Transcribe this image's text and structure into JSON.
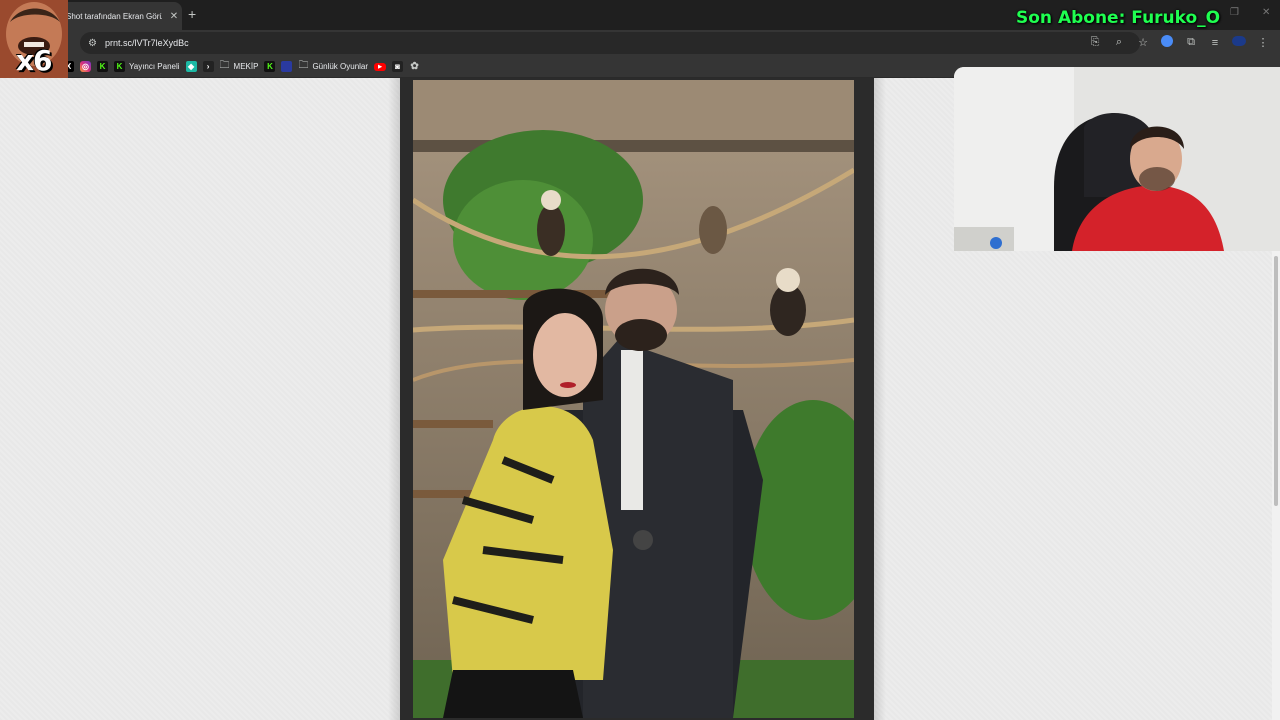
{
  "browser": {
    "tab_title": "Shot tarafından Ekran Görü",
    "tab_close": "✕",
    "new_tab": "+",
    "url": "prnt.sc/lVTr7leXydBc"
  },
  "bookmarks": [
    {
      "label": "",
      "icon": "x-icon"
    },
    {
      "label": "",
      "icon": "instagram-icon"
    },
    {
      "label": "",
      "icon": "kick-icon"
    },
    {
      "label": "Yayıncı Paneli",
      "icon": "kick-icon"
    },
    {
      "label": "",
      "icon": "teal-app-icon"
    },
    {
      "label": "",
      "icon": "arrow-icon"
    },
    {
      "label": "MEKİP",
      "icon": "folder-icon"
    },
    {
      "label": "",
      "icon": "kick-icon"
    },
    {
      "label": "Günlük Oyunlar",
      "icon": "folder-icon"
    },
    {
      "label": "",
      "icon": "youtube-icon"
    },
    {
      "label": "",
      "icon": "game-icon"
    },
    {
      "label": "",
      "icon": "openai-icon"
    }
  ],
  "overlay": {
    "subscriber_text": "Son Abone: Furuko_O",
    "multiplier": "x6"
  },
  "colors": {
    "subscriber_green": "#1fff50",
    "page_bg": "#ececec",
    "browser_dark": "#353535"
  }
}
